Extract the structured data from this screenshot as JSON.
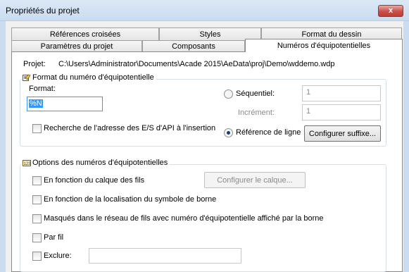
{
  "window": {
    "title": "Propriétés du projet",
    "close_glyph": "x"
  },
  "tabs": {
    "row1": [
      "Références croisées",
      "Styles",
      "Format du dessin"
    ],
    "row2": [
      "Paramètres du projet",
      "Composants",
      "Numéros d'équipotentielles"
    ],
    "active": "Numéros d'équipotentielles"
  },
  "project": {
    "label": "Projet:",
    "path": "C:\\Users\\Administrator\\Documents\\Acade 2015\\AeData\\proj\\Demo\\wddemo.wdp"
  },
  "format_group": {
    "title": "Format du numéro d'équipotentielle",
    "format_label": "Format:",
    "format_value": "%N",
    "sequential_label": "Séquentiel:",
    "sequential_value": "1",
    "sequential_selected": false,
    "increment_label": "Incrément:",
    "increment_value": "1",
    "line_ref_label": "Référence de ligne",
    "line_ref_selected": true,
    "configure_suffix_label": "Configurer suffixe...",
    "api_search_label": "Recherche de l'adresse des E/S d'API à l'insertion",
    "api_search_checked": false
  },
  "options_group": {
    "title": "Options des numéros d'équipotentielles",
    "by_layer_label": "En fonction du calque des fils",
    "configure_layer_label": "Configurer le calque...",
    "by_terminal_label": "En fonction de la localisation du symbole de borne",
    "hidden_label": "Masqués dans le réseau de fils avec numéro d'équipotentielle affiché par la borne",
    "per_wire_label": "Par fil",
    "exclude_label": "Exclure:",
    "exclude_value": ""
  }
}
